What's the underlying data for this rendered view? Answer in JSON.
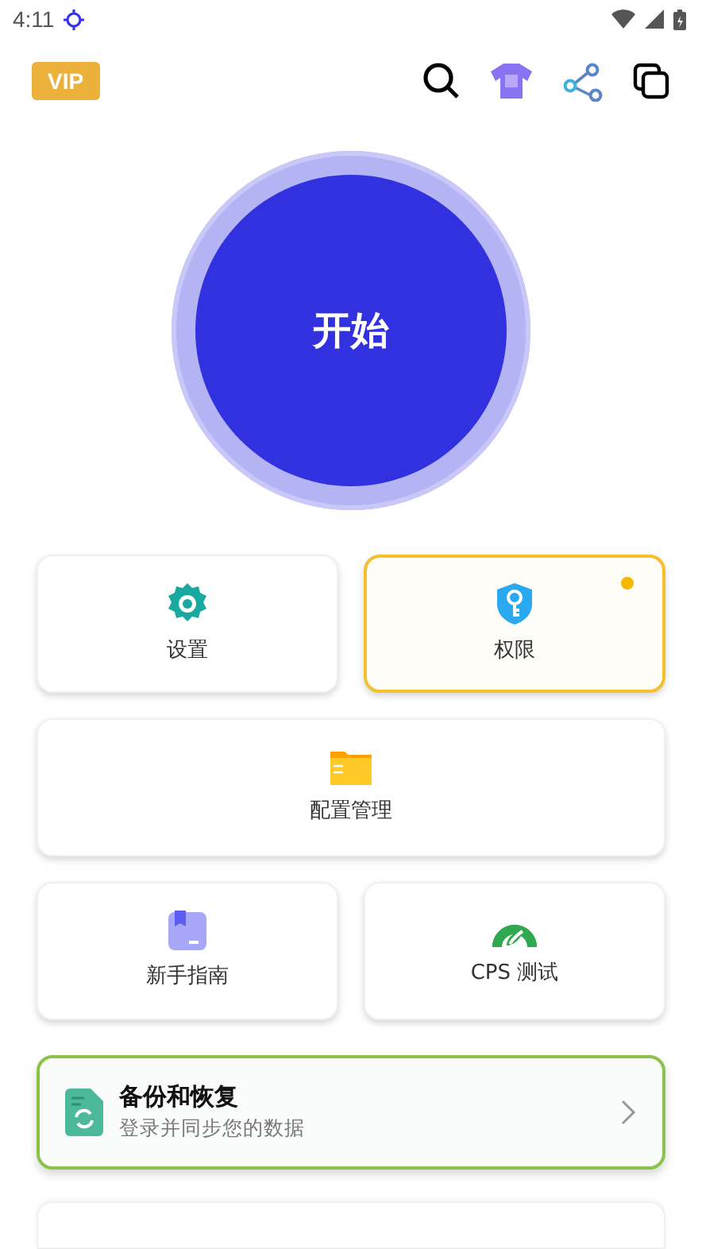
{
  "status_bar": {
    "time": "4:11"
  },
  "header": {
    "badge": "VIP"
  },
  "start_button": {
    "label": "开始"
  },
  "tiles": [
    {
      "label": "设置",
      "kind": "half",
      "highlighted": false,
      "dot": false
    },
    {
      "label": "权限",
      "kind": "half",
      "highlighted": true,
      "dot": true
    },
    {
      "label": "配置管理",
      "kind": "wide",
      "highlighted": false,
      "dot": false
    },
    {
      "label": "新手指南",
      "kind": "half",
      "highlighted": false,
      "dot": false
    },
    {
      "label": "CPS 测试",
      "kind": "half",
      "highlighted": false,
      "dot": false
    }
  ],
  "backup_card": {
    "title": "备份和恢复",
    "subtitle": "登录并同步您的数据"
  }
}
